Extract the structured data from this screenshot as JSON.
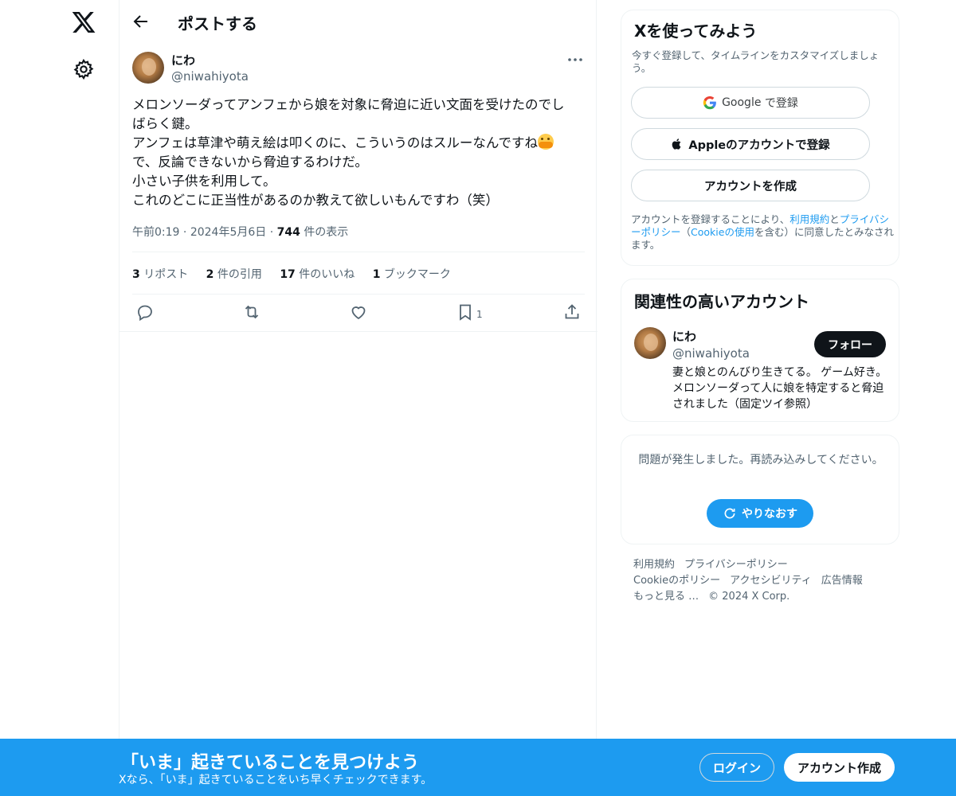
{
  "rail": {
    "logo_icon": "x-logo-icon",
    "settings_icon": "gear-icon"
  },
  "header": {
    "title": "ポストする"
  },
  "post": {
    "author_name": "にわ",
    "author_handle": "@niwahiyota",
    "text_lines": [
      "メロンソーダってアンフェから娘を対象に脅迫に近い文面を受けたのでし",
      "ばらく鍵。",
      "アンフェは草津や萌え絵は叩くのに、こういうのはスルーなんですね",
      "で、反論できないから脅迫するわけだ。",
      "小さい子供を利用して。",
      "これのどこに正当性があるのか教えて欲しいもんですわ（笑）"
    ],
    "time": "午前0:19",
    "date": "2024年5月6日",
    "views_count": "744",
    "views_label": "件の表示",
    "stats": [
      {
        "count": "3",
        "label": "リポスト"
      },
      {
        "count": "2",
        "label": "件の引用"
      },
      {
        "count": "17",
        "label": "件のいいね"
      },
      {
        "count": "1",
        "label": "ブックマーク"
      }
    ],
    "bookmark_count": "1"
  },
  "signup_card": {
    "title": "Xを使ってみよう",
    "subtitle": "今すぐ登録して、タイムラインをカスタマイズしましょう。",
    "google_brand": "Google",
    "google_suffix": "で登録",
    "apple_label": "Appleのアカウントで登録",
    "create_label": "アカウントを作成",
    "legal_pre": "アカウントを登録することにより、",
    "legal_terms": "利用規約",
    "legal_and": "と",
    "legal_privacy": "プライバシーポリシー",
    "legal_paren_open": "（",
    "legal_cookie": "Cookieの使用",
    "legal_post": "を含む）に同意したとみなされます。"
  },
  "related": {
    "title": "関連性の高いアカウント",
    "name": "にわ",
    "handle": "@niwahiyota",
    "follow_label": "フォロー",
    "bio": "妻と娘とのんびり生きてる。 ゲーム好き。 メロンソーダって人に娘を特定すると脅迫されました（固定ツイ参照）"
  },
  "error_card": {
    "message": "問題が発生しました。再読み込みしてください。",
    "retry_label": "やりなおす"
  },
  "footer": {
    "row1": [
      "利用規約",
      "プライバシーポリシー"
    ],
    "row2": [
      "Cookieのポリシー",
      "アクセシビリティ",
      "広告情報"
    ],
    "more": "もっと見る …",
    "copyright": "© 2024 X Corp."
  },
  "banner": {
    "title": "「いま」起きていることを見つけよう",
    "subtitle": "Xなら、「いま」起きていることをいち早くチェックできます。",
    "login_label": "ログイン",
    "signup_label": "アカウント作成"
  },
  "colors": {
    "accent": "#1d9bf0",
    "text": "#0f1419",
    "muted": "#536471",
    "border": "#eff3f4"
  }
}
